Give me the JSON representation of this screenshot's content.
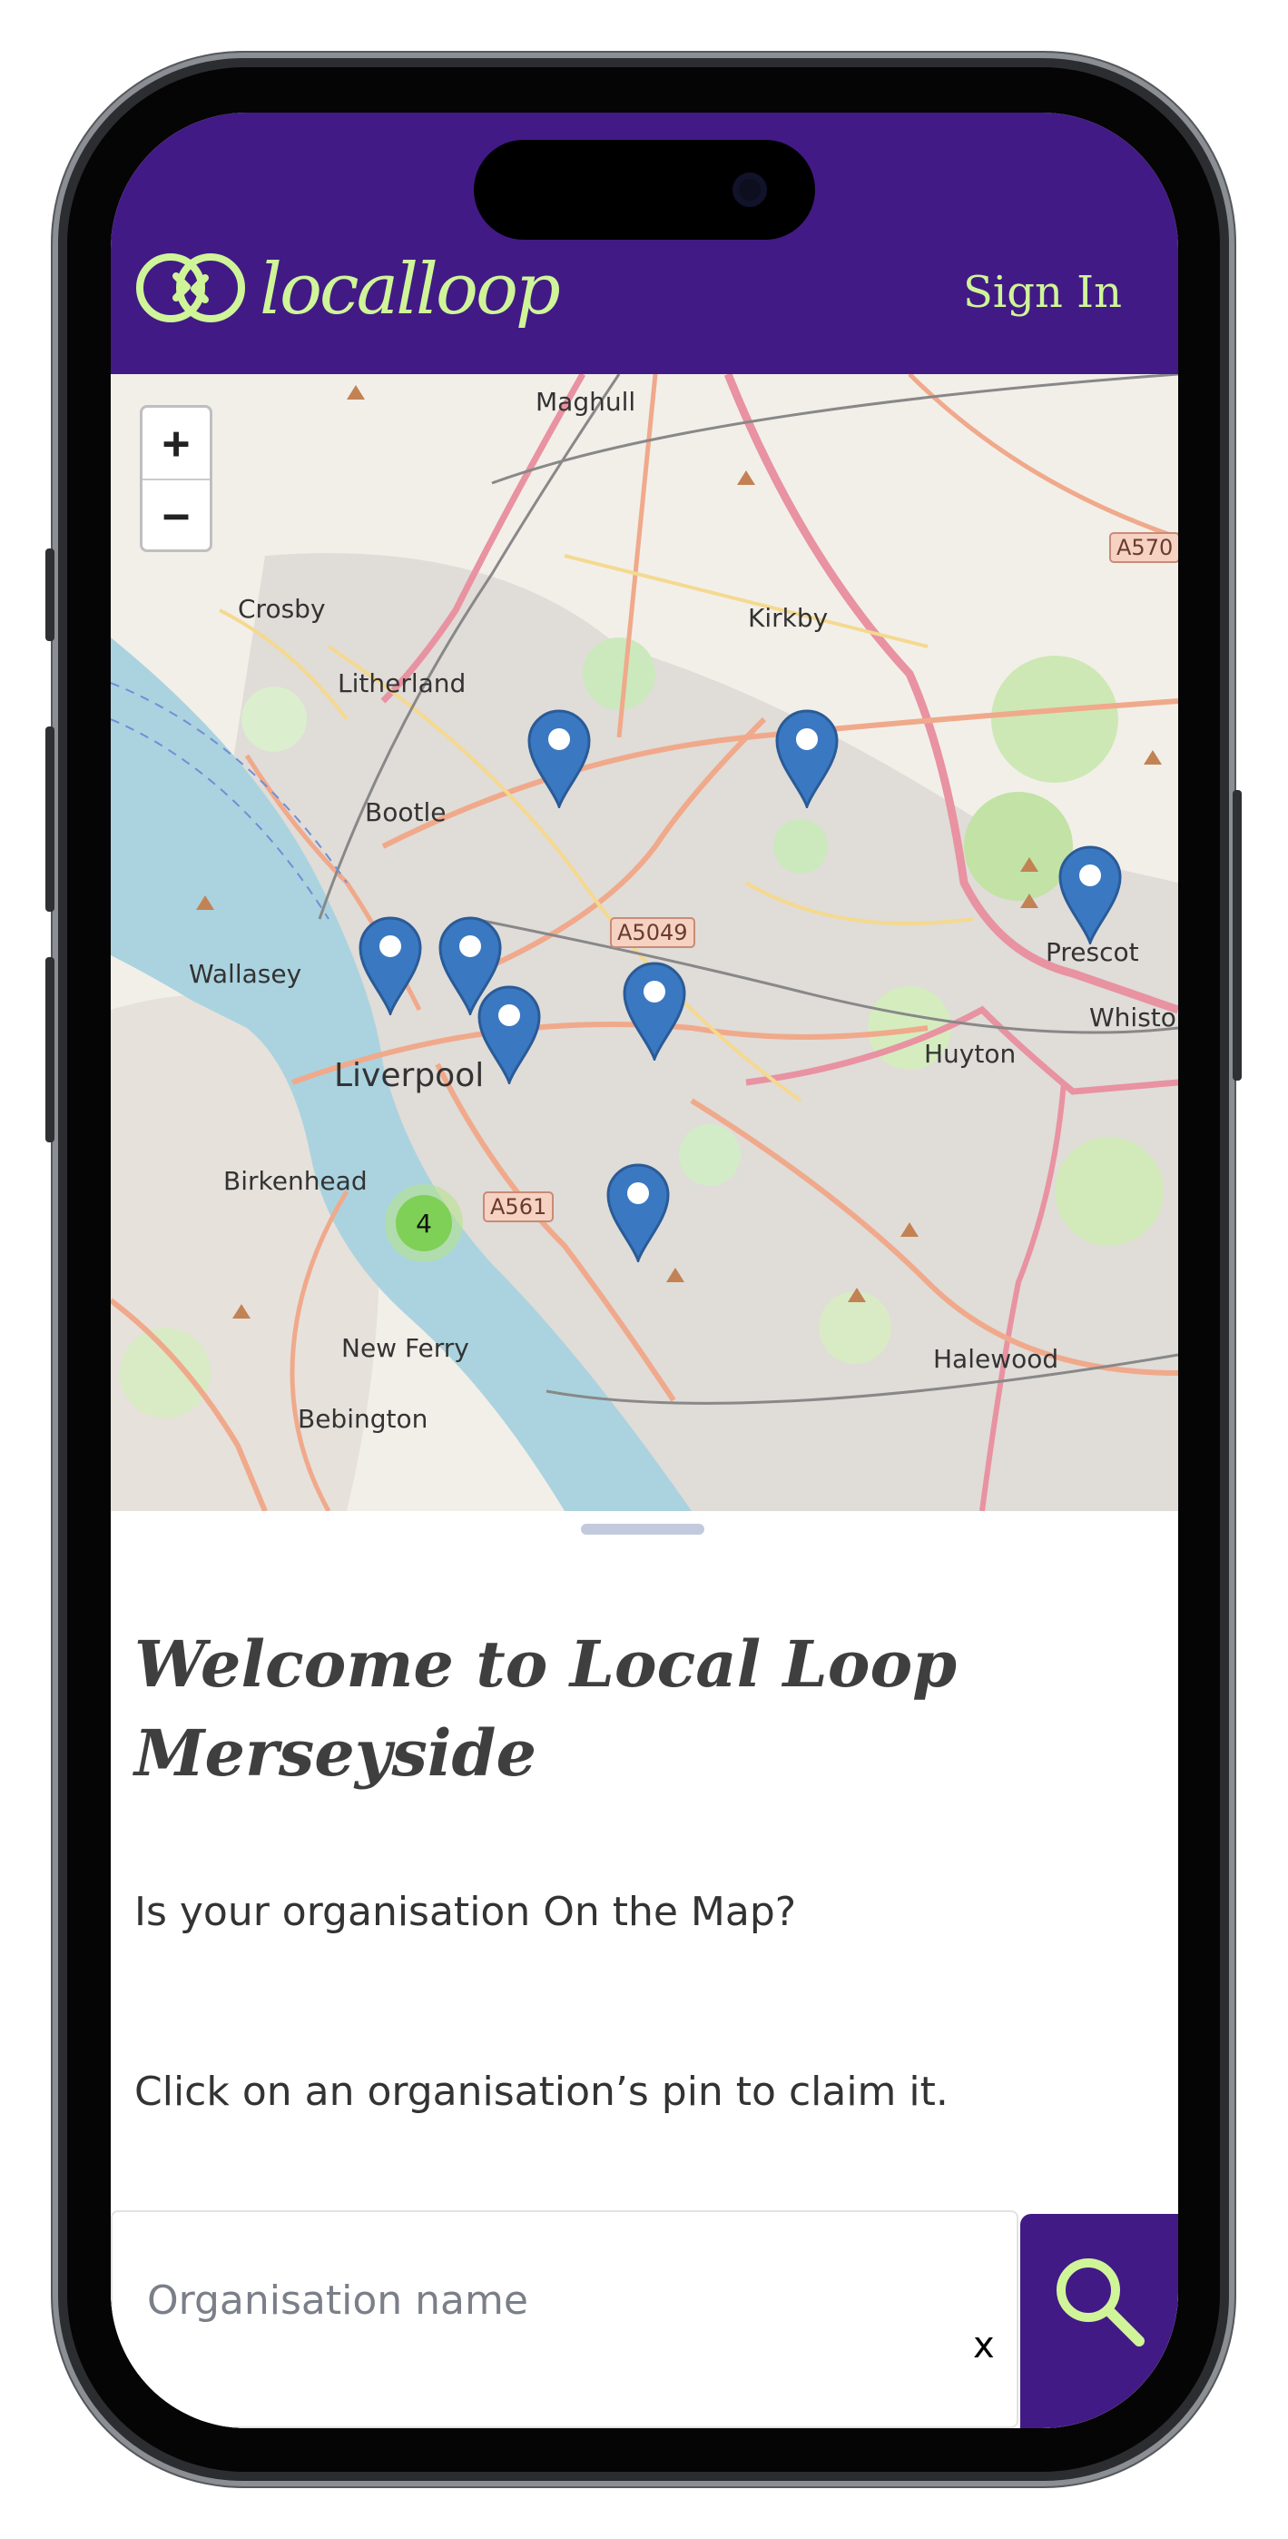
{
  "header": {
    "logo_text": "localloop",
    "sign_in_label": "Sign In",
    "background_color": "#421a85",
    "accent_color": "#cff598"
  },
  "map": {
    "zoom_in_label": "+",
    "zoom_out_label": "−",
    "places": [
      "Maghull",
      "Kirkby",
      "Crosby",
      "Litherland",
      "Bootle",
      "Wallasey",
      "Liverpool",
      "Birkenhead",
      "Huyton",
      "Prescot",
      "Whisto",
      "New Ferry",
      "Bebington",
      "Halewood"
    ],
    "road_shields": [
      "A570",
      "A5049",
      "A561"
    ],
    "cluster_count": "4",
    "pin_count": 8,
    "pin_color": "#3a78c2"
  },
  "sheet": {
    "title": "Welcome to Local Loop Merseyside",
    "line1": "Is your organisation On the Map?",
    "line2": "Click on an organisation’s pin to claim it.",
    "search_placeholder": "Organisation name",
    "clear_label": "x",
    "search_icon": "search-icon"
  }
}
